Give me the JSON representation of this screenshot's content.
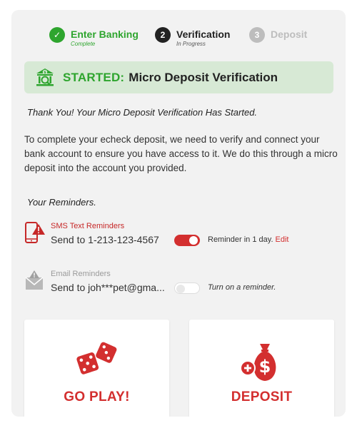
{
  "stepper": {
    "steps": [
      {
        "number": "✓",
        "title": "Enter Banking",
        "subtitle": "Complete",
        "state": "complete"
      },
      {
        "number": "2",
        "title": "Verification",
        "subtitle": "In Progress",
        "state": "active"
      },
      {
        "number": "3",
        "title": "Deposit",
        "subtitle": "",
        "state": "pending"
      }
    ]
  },
  "banner": {
    "icon": "bank-search-icon",
    "label": "STARTED:",
    "text": "Micro Deposit Verification"
  },
  "thanks": "Thank You! Your Micro Deposit Verification Has Started.",
  "description": "To complete your echeck deposit, we need to verify and connect your bank account to ensure you have access to it. We do this through a micro deposit into the account you provided.",
  "reminders": {
    "title": "Your Reminders.",
    "sms": {
      "icon": "phone-alert-icon",
      "label": "SMS Text Reminders",
      "send_to": "Send to 1-213-123-4567",
      "toggle_on": true,
      "note": "Reminder in 1 day.",
      "edit_label": "Edit"
    },
    "email": {
      "icon": "email-alert-icon",
      "label": "Email Reminders",
      "send_to": "Send to joh***pet@gma...",
      "toggle_on": false,
      "note": "Turn on a reminder."
    }
  },
  "cards": {
    "play": {
      "icon": "dice-icon",
      "label": "GO PLAY!"
    },
    "deposit": {
      "icon": "money-bag-plus-icon",
      "label": "DEPOSIT"
    }
  },
  "colors": {
    "green": "#2ea52e",
    "red": "#d32f2f",
    "banner_bg": "#d7e9d5",
    "panel_bg": "#f2f2f2"
  }
}
